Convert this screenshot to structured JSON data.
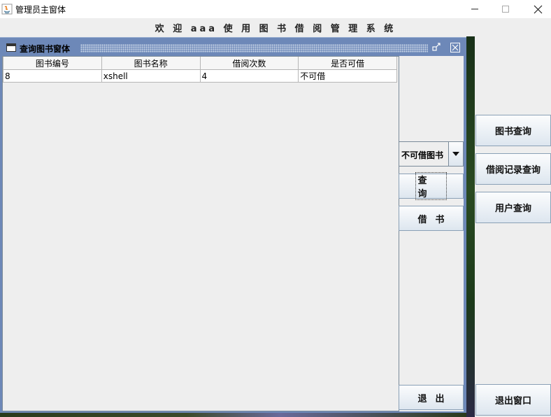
{
  "window": {
    "title": "管理员主窗体"
  },
  "welcome": {
    "text": "欢 迎 aaa 使 用 图 书 借 阅 管 理 系 统"
  },
  "internal_frame": {
    "title": "查询图书窗体"
  },
  "table": {
    "columns": [
      "图书编号",
      "图书名称",
      "借阅次数",
      "是否可借"
    ],
    "rows": [
      [
        "8",
        "xshell",
        "4",
        "不可借"
      ]
    ]
  },
  "combo": {
    "selected": "不可借图书"
  },
  "frame_buttons": {
    "query": "查询",
    "borrow": "借书",
    "exit": "退出"
  },
  "side_buttons": {
    "book_query": "图书查询",
    "borrow_record_query": "借阅记录查询",
    "user_query": "用户查询",
    "exit_window": "退出窗口"
  }
}
